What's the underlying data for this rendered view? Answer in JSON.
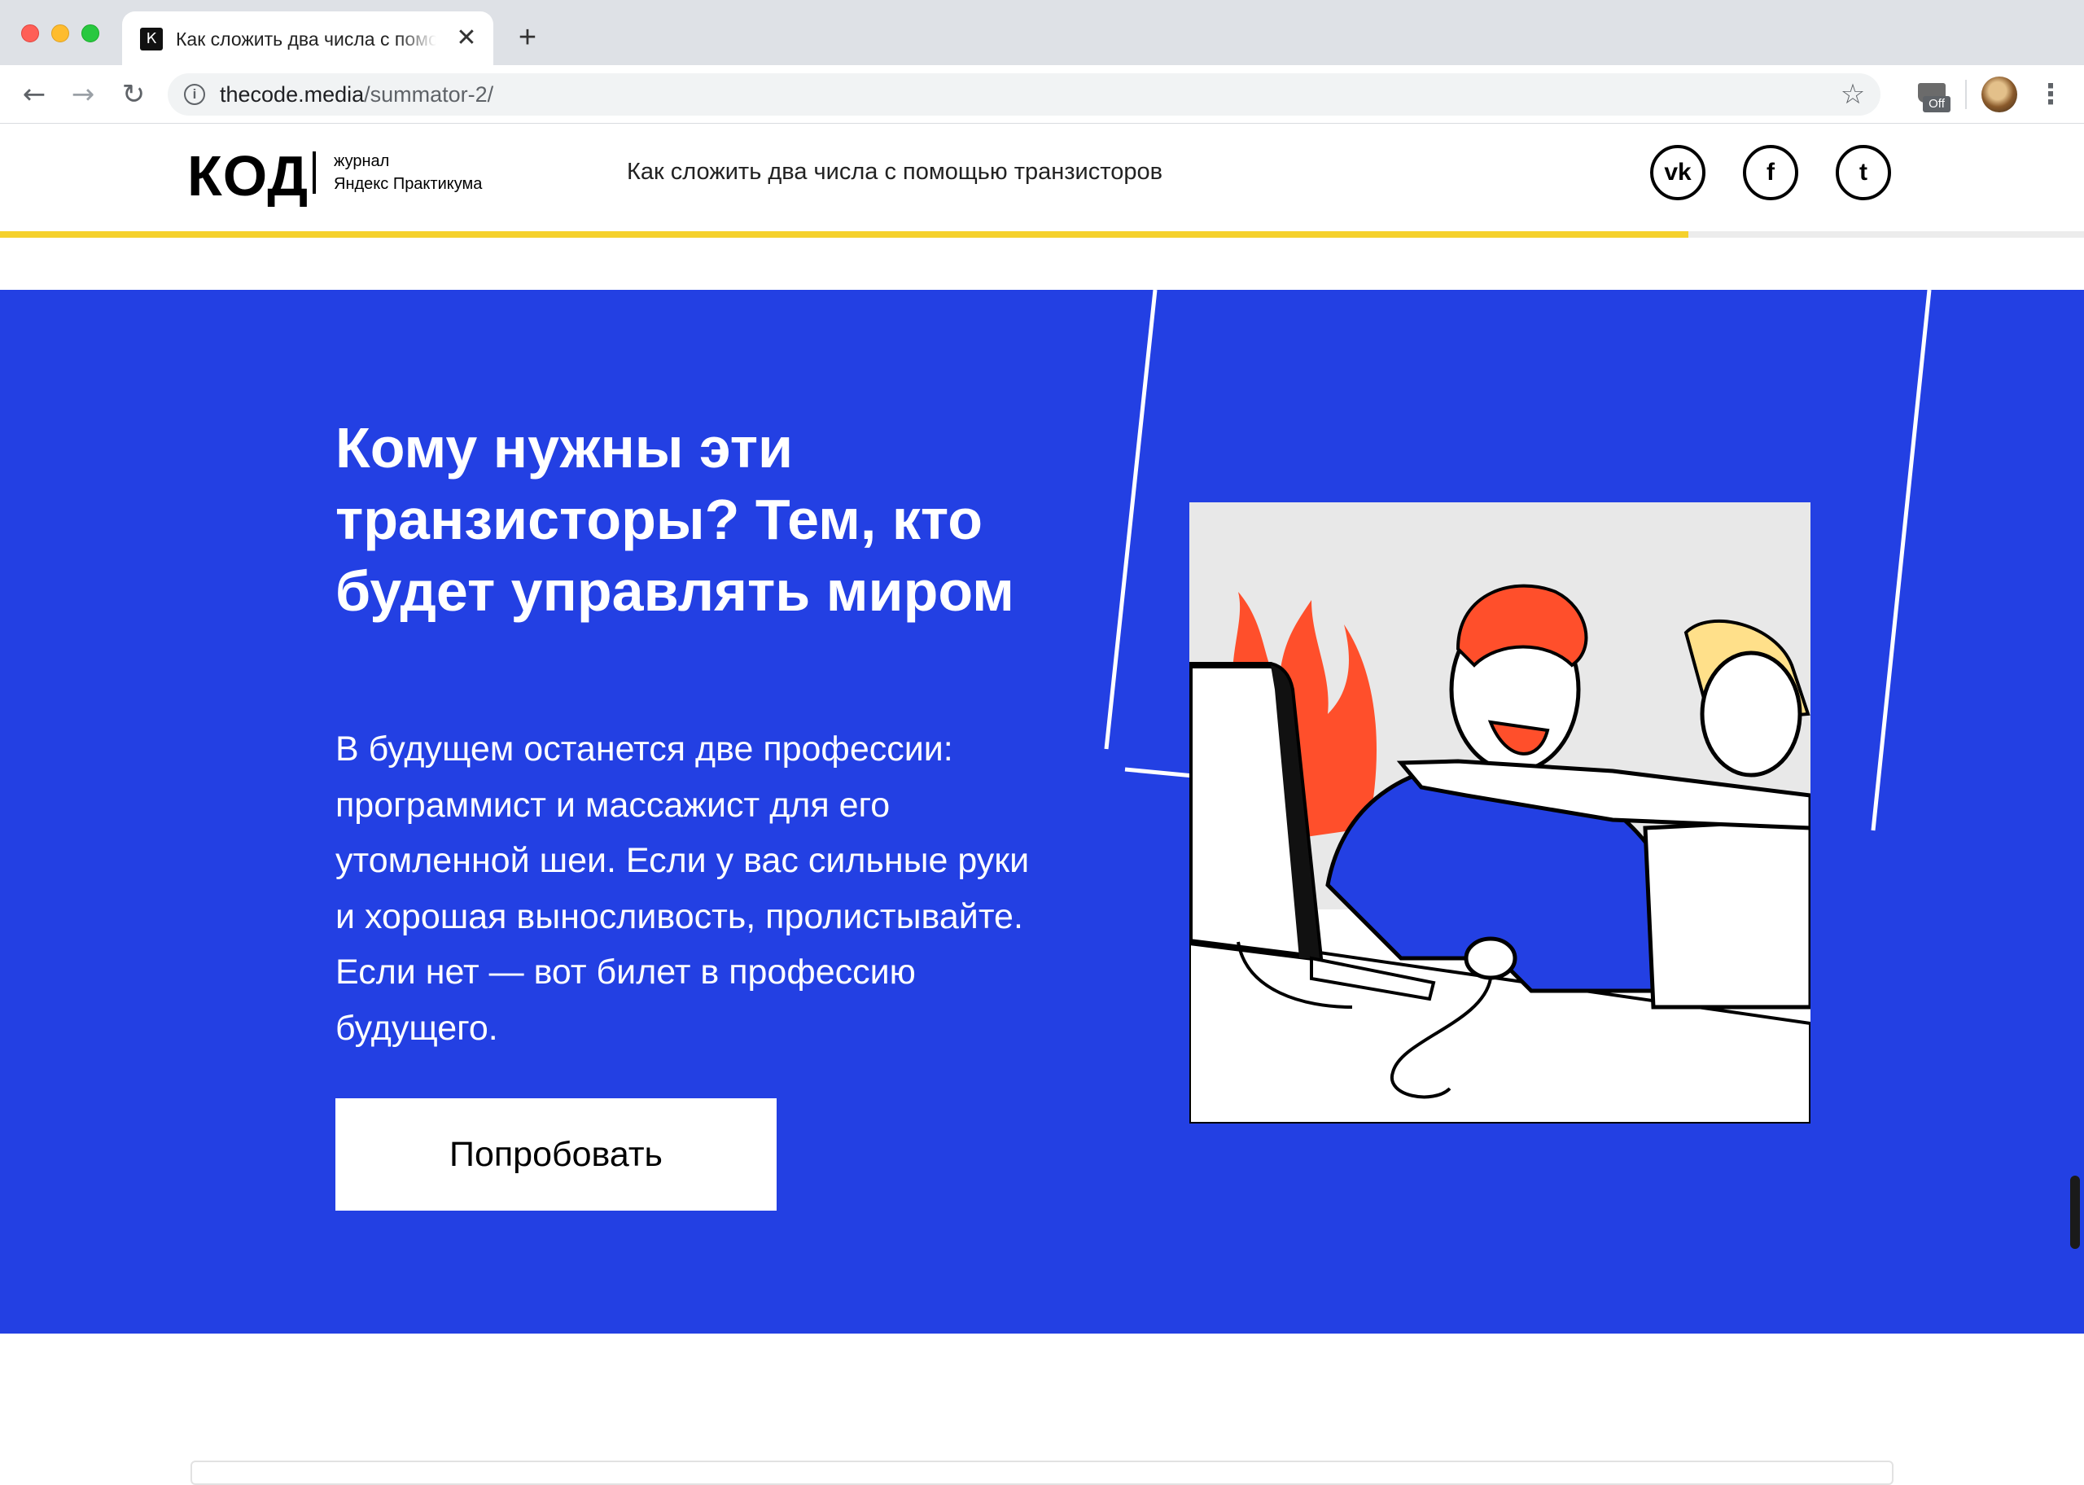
{
  "browser": {
    "tab": {
      "favicon": "К",
      "title": "Как сложить два числа с помо",
      "close_icon": "✕"
    },
    "new_tab_icon": "+",
    "nav": {
      "back_icon": "←",
      "forward_icon": "→",
      "reload_icon": "↻"
    },
    "address": {
      "host": "thecode.media",
      "path": "/summator-2/"
    },
    "star_icon": "☆",
    "extension_badge": "Off",
    "menu_icon": "⋮"
  },
  "site": {
    "logo": "КОД",
    "logo_sub_line1": "журнал",
    "logo_sub_line2": "Яндекс Практикума",
    "header_title": "Как сложить два числа с помощью транзисторов",
    "social": {
      "vk": "vk",
      "facebook": "f",
      "twitter": "t"
    },
    "reading_progress": 0.81,
    "colors": {
      "accent_yellow": "#f5d12c",
      "promo_blue": "#2340e3"
    }
  },
  "promo": {
    "title": "Кому нужны эти транзисторы? Тем, кто будет управлять миром",
    "text": "В будущем останется две профессии: программист и массажист для его утомленной шеи. Если у вас сильные руки и хорошая выносливость, проли­стывайте. Если нет — вот билет в про­фессию будущего.",
    "button": "Попробовать"
  }
}
